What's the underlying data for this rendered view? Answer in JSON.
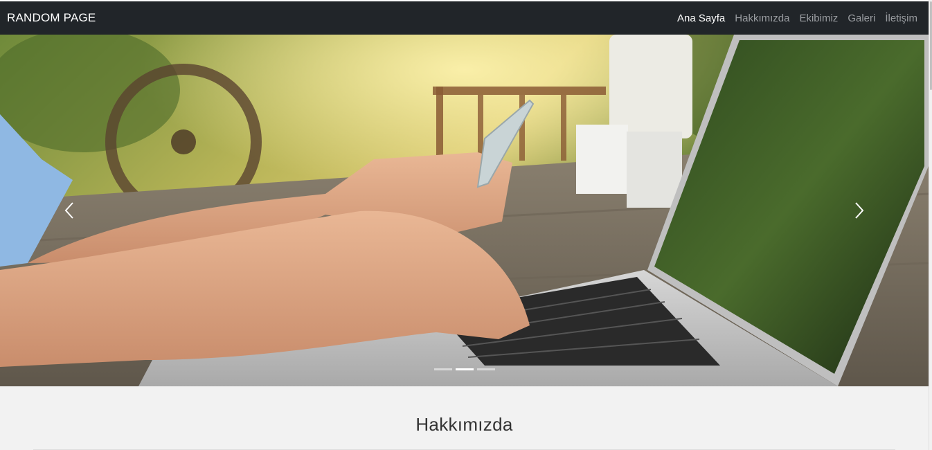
{
  "navbar": {
    "brand": "RANDOM PAGE",
    "links": [
      {
        "label": "Ana Sayfa",
        "active": true
      },
      {
        "label": "Hakkımızda",
        "active": false
      },
      {
        "label": "Ekibimiz",
        "active": false
      },
      {
        "label": "Galeri",
        "active": false
      },
      {
        "label": "İletişim",
        "active": false
      }
    ]
  },
  "carousel": {
    "slide_count": 3,
    "active_index": 1,
    "prev_icon": "chevron-left-icon",
    "next_icon": "chevron-right-icon"
  },
  "about": {
    "title": "Hakkımızda"
  },
  "colors": {
    "navbar_bg": "#212529",
    "nav_active": "#ffffff",
    "nav_inactive": "#9a9da1",
    "page_bg": "#f2f2f2"
  }
}
